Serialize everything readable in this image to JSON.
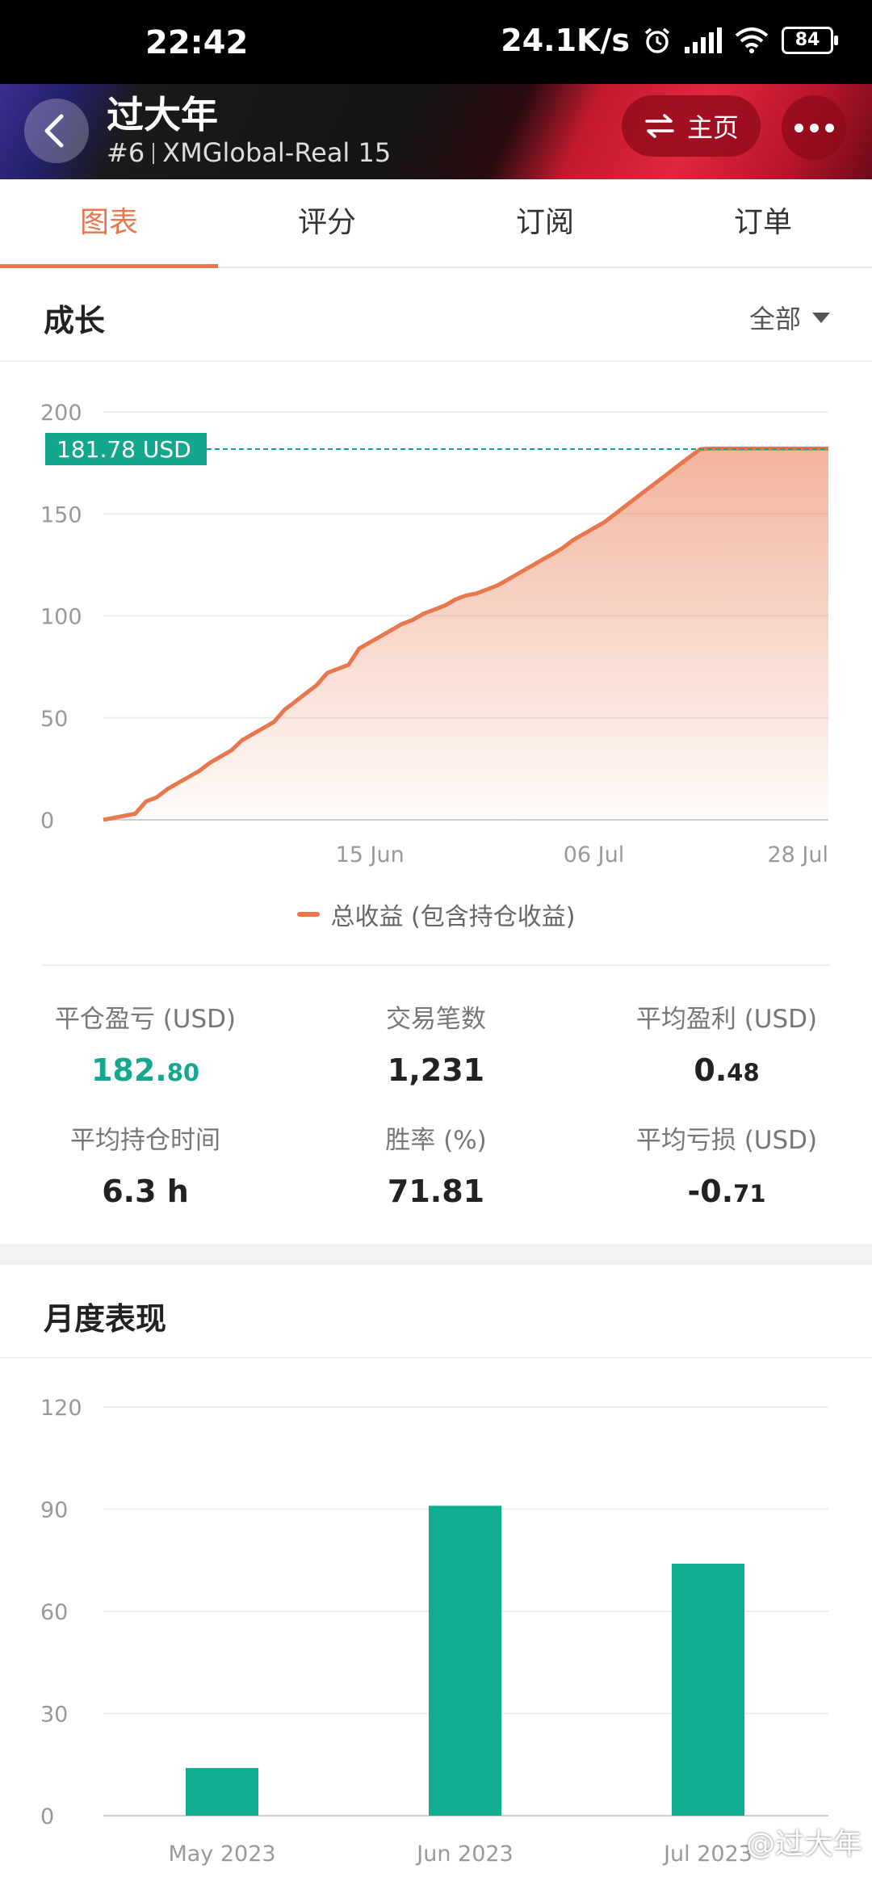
{
  "status_bar": {
    "time": "22:42",
    "speed": "24.1K/s",
    "battery": "84"
  },
  "header": {
    "title": "过大年",
    "rank": "#6",
    "account": "XMGlobal-Real 15",
    "home_label": "主页"
  },
  "tabs": [
    {
      "label": "图表",
      "active": true
    },
    {
      "label": "评分"
    },
    {
      "label": "订阅"
    },
    {
      "label": "订单"
    }
  ],
  "growth": {
    "title": "成长",
    "filter": "全部",
    "legend": "总收益 (包含持仓收益)",
    "current_label": "181.78 USD",
    "colors": {
      "line": "#e8774d",
      "marker": "#13a88e"
    }
  },
  "stats": [
    {
      "label": "平仓盈亏 (USD)",
      "int": "182.",
      "dec": "80",
      "highlight": true
    },
    {
      "label": "交易笔数",
      "int": "1,231",
      "dec": ""
    },
    {
      "label": "平均盈利 (USD)",
      "int": "0.",
      "dec": "48"
    },
    {
      "label": "平均持仓时间",
      "int": "6.3 h",
      "dec": ""
    },
    {
      "label": "胜率 (%)",
      "int": "71.81",
      "dec": ""
    },
    {
      "label": "平均亏损 (USD)",
      "int": "-0.",
      "dec": "71"
    }
  ],
  "monthly": {
    "title": "月度表现",
    "color": "#0fae90"
  },
  "watermark": "@过大年",
  "chart_data": [
    {
      "type": "area",
      "ylim": [
        0,
        200
      ],
      "yticks": [
        0,
        50,
        100,
        150,
        200
      ],
      "x_ticks": [
        "15 Jun",
        "06 Jul",
        "28 Jul"
      ],
      "x_tick_index": [
        25,
        46,
        68
      ],
      "x": [
        "24 May",
        "25 May",
        "26 May",
        "27 May",
        "28 May",
        "29 May",
        "30 May",
        "31 May",
        "01 Jun",
        "02 Jun",
        "03 Jun",
        "04 Jun",
        "05 Jun",
        "06 Jun",
        "07 Jun",
        "08 Jun",
        "09 Jun",
        "10 Jun",
        "11 Jun",
        "12 Jun",
        "13 Jun",
        "14 Jun",
        "15 Jun",
        "16 Jun",
        "17 Jun",
        "18 Jun",
        "19 Jun",
        "20 Jun",
        "21 Jun",
        "22 Jun",
        "23 Jun",
        "24 Jun",
        "25 Jun",
        "26 Jun",
        "27 Jun",
        "28 Jun",
        "29 Jun",
        "30 Jun",
        "01 Jul",
        "02 Jul",
        "03 Jul",
        "04 Jul",
        "05 Jul",
        "06 Jul",
        "07 Jul",
        "08 Jul",
        "09 Jul",
        "10 Jul",
        "11 Jul",
        "12 Jul",
        "13 Jul",
        "14 Jul",
        "15 Jul",
        "16 Jul",
        "17 Jul",
        "18 Jul",
        "19 Jul",
        "20 Jul",
        "21 Jul",
        "22 Jul",
        "23 Jul",
        "24 Jul",
        "25 Jul",
        "26 Jul",
        "27 Jul",
        "28 Jul",
        "29 Jul",
        "30 Jul",
        "31 Jul"
      ],
      "values": [
        0,
        1,
        2,
        3,
        9,
        11,
        15,
        18,
        21,
        24,
        28,
        31,
        34,
        39,
        42,
        45,
        48,
        54,
        58,
        62,
        66,
        72,
        74,
        76,
        84,
        87,
        90,
        93,
        96,
        98,
        101,
        103,
        105,
        108,
        110,
        111,
        113,
        115,
        118,
        121,
        124,
        127,
        130,
        133,
        137,
        140,
        143,
        146,
        150,
        154,
        158,
        162,
        166,
        170,
        174,
        178,
        181.78,
        182,
        182,
        182,
        182,
        182,
        182,
        182,
        182,
        182,
        182,
        182,
        182
      ],
      "annotation": "181.78 USD"
    },
    {
      "type": "bar",
      "categories": [
        "May 2023",
        "Jun 2023",
        "Jul 2023"
      ],
      "values": [
        14,
        91,
        74
      ],
      "ylim": [
        0,
        120
      ],
      "yticks": [
        0,
        30,
        60,
        90,
        120
      ]
    }
  ]
}
